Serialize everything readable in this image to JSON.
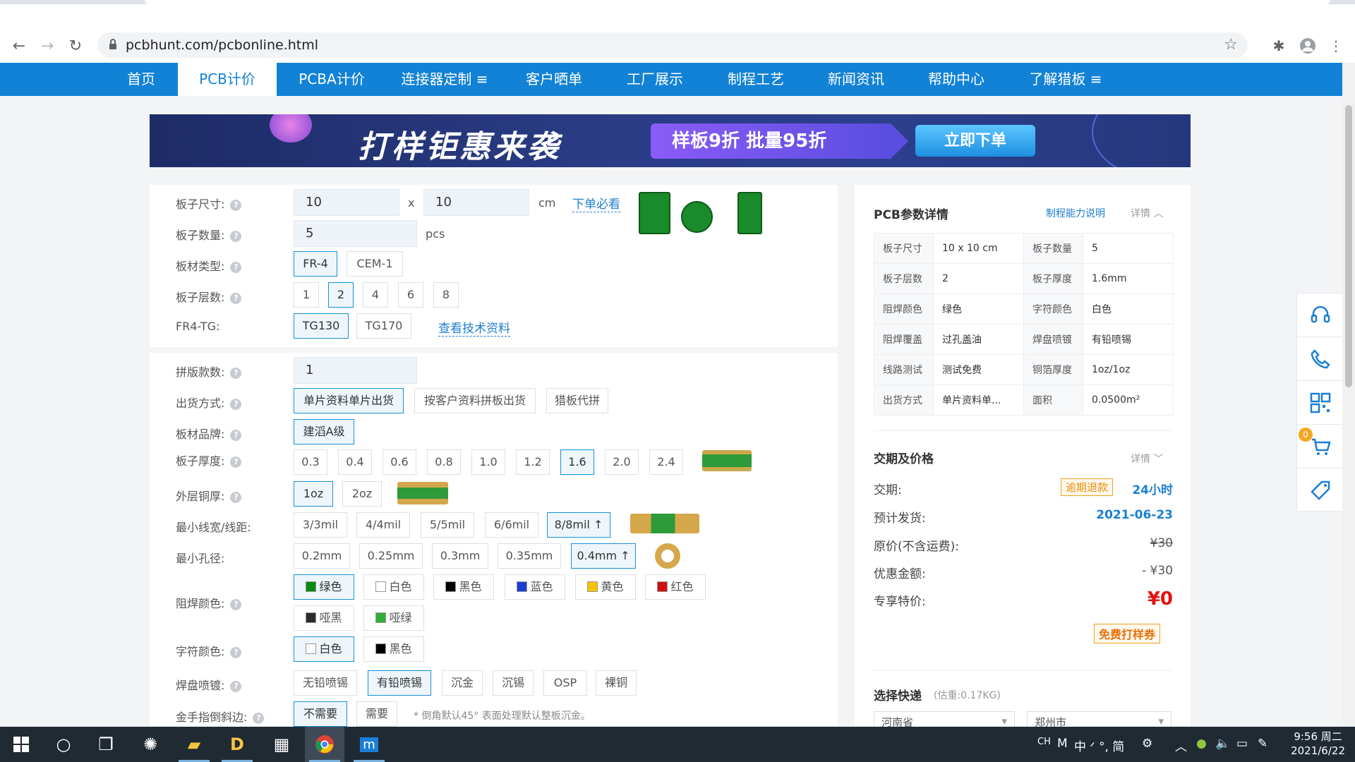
{
  "browser": {
    "url": "pcbhunt.com/pcbonline.html"
  },
  "nav": {
    "items": [
      {
        "label": "首页"
      },
      {
        "label": "PCB计价"
      },
      {
        "label": "PCBA计价"
      },
      {
        "label": "连接器定制 ≡"
      },
      {
        "label": "客户晒单"
      },
      {
        "label": "工厂展示"
      },
      {
        "label": "制程工艺"
      },
      {
        "label": "新闻资讯"
      },
      {
        "label": "帮助中心"
      },
      {
        "label": "了解猎板 ≡"
      }
    ],
    "active_index": 1
  },
  "banner": {
    "headline": "打样钜惠来袭",
    "promo": "样板9折  批量95折",
    "cta": "立即下单"
  },
  "form": {
    "size": {
      "label": "板子尺寸:",
      "w": "10",
      "x": "x",
      "h": "10",
      "unit": "cm",
      "link": "下单必看"
    },
    "qty": {
      "label": "板子数量:",
      "value": "5",
      "unit": "pcs"
    },
    "material": {
      "label": "板材类型:",
      "options": [
        "FR-4",
        "CEM-1"
      ],
      "selected": "FR-4"
    },
    "layers": {
      "label": "板子层数:",
      "options": [
        "1",
        "2",
        "4",
        "6",
        "8"
      ],
      "selected": "2"
    },
    "tg": {
      "label": "FR4-TG:",
      "options": [
        "TG130",
        "TG170"
      ],
      "selected": "TG130",
      "link": "查看技术资料"
    },
    "panel_count": {
      "label": "拼版款数:",
      "value": "1"
    },
    "ship_mode": {
      "label": "出货方式:",
      "options": [
        "单片资料单片出货",
        "按客户资料拼板出货",
        "猎板代拼"
      ],
      "selected": "单片资料单片出货"
    },
    "brand": {
      "label": "板材品牌:",
      "options": [
        "建滔A级"
      ],
      "selected": "建滔A级"
    },
    "thickness": {
      "label": "板子厚度:",
      "options": [
        "0.3",
        "0.4",
        "0.6",
        "0.8",
        "1.0",
        "1.2",
        "1.6",
        "2.0",
        "2.4"
      ],
      "selected": "1.6"
    },
    "copper": {
      "label": "外层铜厚:",
      "options": [
        "1oz",
        "2oz"
      ],
      "selected": "1oz"
    },
    "trace": {
      "label": "最小线宽/线距:",
      "options": [
        "3/3mil",
        "4/4mil",
        "5/5mil",
        "6/6mil",
        "8/8mil ↑"
      ],
      "selected": "8/8mil ↑"
    },
    "hole": {
      "label": "最小孔径:",
      "options": [
        "0.2mm",
        "0.25mm",
        "0.3mm",
        "0.35mm",
        "0.4mm ↑"
      ],
      "selected": "0.4mm ↑"
    },
    "mask_color": {
      "label": "阻焊颜色:",
      "options": [
        {
          "name": "绿色",
          "color": "#0a8a12"
        },
        {
          "name": "白色",
          "color": "#ffffff"
        },
        {
          "name": "黑色",
          "color": "#000000"
        },
        {
          "name": "蓝色",
          "color": "#1a3fd0"
        },
        {
          "name": "黄色",
          "color": "#f5c400"
        },
        {
          "name": "红色",
          "color": "#d01010"
        },
        {
          "name": "哑黑",
          "color": "#2a2a2a"
        },
        {
          "name": "哑绿",
          "color": "#2fae3a"
        }
      ],
      "selected": "绿色"
    },
    "silk_color": {
      "label": "字符颜色:",
      "options": [
        {
          "name": "白色",
          "color": "#ffffff"
        },
        {
          "name": "黑色",
          "color": "#000000"
        }
      ],
      "selected": "白色"
    },
    "finish": {
      "label": "焊盘喷镀:",
      "options": [
        "无铅喷锡",
        "有铅喷锡",
        "沉金",
        "沉锡",
        "OSP",
        "裸铜"
      ],
      "selected": "有铅喷锡"
    },
    "bevel": {
      "label": "金手指倒斜边:",
      "options": [
        "不需要",
        "需要"
      ],
      "selected": "不需要",
      "note": "* 倒角默认45° 表面处理默认整板沉金。"
    }
  },
  "params": {
    "title": "PCB参数详情",
    "link": "制程能力说明",
    "toggle": "详情 ︿",
    "rows": [
      [
        "板子尺寸",
        "10 x 10 cm",
        "板子数量",
        "5"
      ],
      [
        "板子层数",
        "2",
        "板子厚度",
        "1.6mm"
      ],
      [
        "阻焊颜色",
        "绿色",
        "字符颜色",
        "白色"
      ],
      [
        "阻焊覆盖",
        "过孔盖油",
        "焊盘喷镀",
        "有铅喷锡"
      ],
      [
        "线路测试",
        "测试免费",
        "铜箔厚度",
        "1oz/1oz"
      ],
      [
        "出货方式",
        "单片资料单...",
        "面积",
        "0.0500m²"
      ]
    ]
  },
  "price": {
    "title": "交期及价格",
    "toggle": "详情 ﹀",
    "lead_label": "交期:",
    "lead_tag": "逾期退款",
    "lead_value": "24小时",
    "ship_label": "预计发货:",
    "ship_value": "2021-06-23",
    "orig_label": "原价(不含运费):",
    "orig_value": "¥30",
    "discount_label": "优惠金额:",
    "discount_value": "- ¥30",
    "special_label": "专享特价:",
    "special_value": "¥0",
    "coupon": "免费打样券"
  },
  "shipping": {
    "title": "选择快递",
    "weight": "(估重:0.17KG)",
    "province": "河南省",
    "city": "郑州市"
  },
  "sidebar": {
    "cart_count": "0"
  },
  "taskbar": {
    "ime": "CH",
    "tray_text": "中 ᐟ °, 简",
    "time": "9:56 周二",
    "date": "2021/6/22"
  }
}
